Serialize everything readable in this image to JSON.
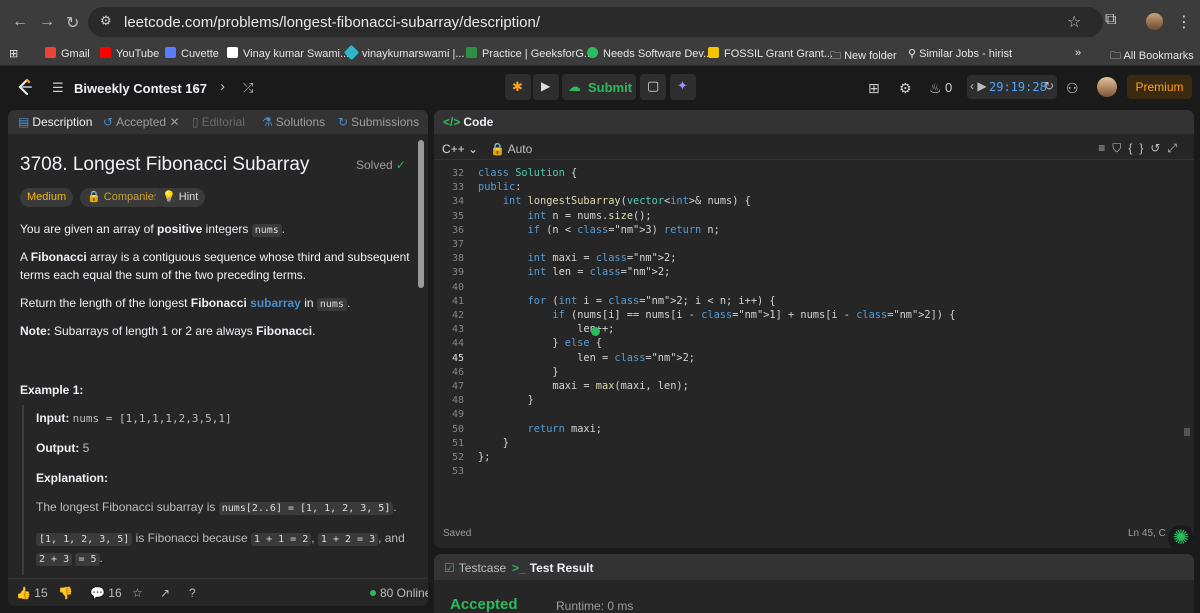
{
  "browser": {
    "url": "leetcode.com/problems/longest-fibonacci-subarray/description/",
    "bookmarks": [
      {
        "label": "Gmail",
        "color": "#ea4335"
      },
      {
        "label": "YouTube",
        "color": "#ff0000"
      },
      {
        "label": "Cuvette",
        "color": "#5a7cff"
      },
      {
        "label": "Vinay kumar Swami...",
        "color": "#ffffff"
      },
      {
        "label": "vinaykumarswami |...",
        "color": "#2fb4c8"
      },
      {
        "label": "Practice | GeeksforG...",
        "color": "#2f8d46"
      },
      {
        "label": "Needs Software Dev...",
        "color": "#2cbb5d"
      },
      {
        "label": "FOSSIL Grant Grant...",
        "color": "#f5c400"
      },
      {
        "label": "New folder",
        "color": "#bdbdbd"
      },
      {
        "label": "Similar Jobs - hirist",
        "color": "#bdbdbd"
      }
    ],
    "all_bookmarks": "All Bookmarks"
  },
  "nav": {
    "contest_title": "Biweekly Contest 167",
    "submit_label": "Submit",
    "streak_count": "0",
    "timer": "29:19:28",
    "premium_label": "Premium"
  },
  "left_tabs": [
    {
      "label": "Description"
    },
    {
      "label": "Accepted"
    },
    {
      "label": "Editorial"
    },
    {
      "label": "Solutions"
    },
    {
      "label": "Submissions"
    }
  ],
  "problem": {
    "title": "3708. Longest Fibonacci Subarray",
    "solved_label": "Solved",
    "difficulty": "Medium",
    "companies_label": "Companies",
    "hint_label": "Hint",
    "p1_pre": "You are given an array of ",
    "p1_bold": "positive",
    "p1_mid": " integers ",
    "p1_code": "nums",
    "p1_end": ".",
    "p2_pre": "A ",
    "p2_bold": "Fibonacci",
    "p2_rest": " array is a contiguous sequence whose third and subsequent terms each equal the sum of the two preceding terms.",
    "p3_pre": "Return the length of the longest ",
    "p3_bold": "Fibonacci",
    "p3_link": "subarray",
    "p3_mid": " in ",
    "p3_code": "nums",
    "p3_end": ".",
    "p4_bold": "Note:",
    "p4_rest": " Subarrays of length 1 or 2 are always ",
    "p4_bold2": "Fibonacci",
    "p4_end": ".",
    "example_title": "Example 1:",
    "input_label": "Input:",
    "input_value": "nums = [1,1,1,1,2,3,5,1]",
    "output_label": "Output:",
    "output_value": "5",
    "explanation_label": "Explanation:",
    "expl1_pre": "The longest Fibonacci subarray is ",
    "expl1_code": "nums[2..6] = [1, 1, 2, 3, 5]",
    "expl1_end": ".",
    "expl2_code1": "[1, 1, 2, 3, 5]",
    "expl2_t1": " is Fibonacci because ",
    "expl2_code2": "1 + 1 = 2",
    "expl2_t2": ", ",
    "expl2_code3": "1 + 2 = 3",
    "expl2_t3": ", and ",
    "expl2_code4": "2 + 3",
    "expl2_code5": "= 5",
    "expl2_end": "."
  },
  "footer": {
    "likes": "15",
    "comments": "16",
    "online": "80 Online"
  },
  "editor": {
    "tab_label": "Code",
    "language": "C++",
    "auto_label": "Auto",
    "saved_label": "Saved",
    "cursor_pos": "Ln 45, C",
    "line_numbers": [
      "32",
      "33",
      "34",
      "35",
      "36",
      "37",
      "38",
      "39",
      "40",
      "41",
      "42",
      "43",
      "44",
      "45",
      "46",
      "47",
      "48",
      "49",
      "50",
      "51",
      "52",
      "53"
    ],
    "code_lines": [
      "class Solution {",
      "public:",
      "    int longestSubarray(vector<int>& nums) {",
      "        int n = nums.size();",
      "        if (n < 3) return n;",
      "",
      "        int maxi = 2;",
      "        int len = 2;",
      "",
      "        for (int i = 2; i < n; i++) {",
      "            if (nums[i] == nums[i - 1] + nums[i - 2]) {",
      "                len++;",
      "            } else {",
      "                len = 2;",
      "            }",
      "            maxi = max(maxi, len);",
      "        }",
      "",
      "        return maxi;",
      "    }",
      "};",
      ""
    ]
  },
  "test": {
    "testcase_label": "Testcase",
    "result_label": "Test Result",
    "status": "Accepted",
    "runtime": "Runtime: 0 ms"
  }
}
